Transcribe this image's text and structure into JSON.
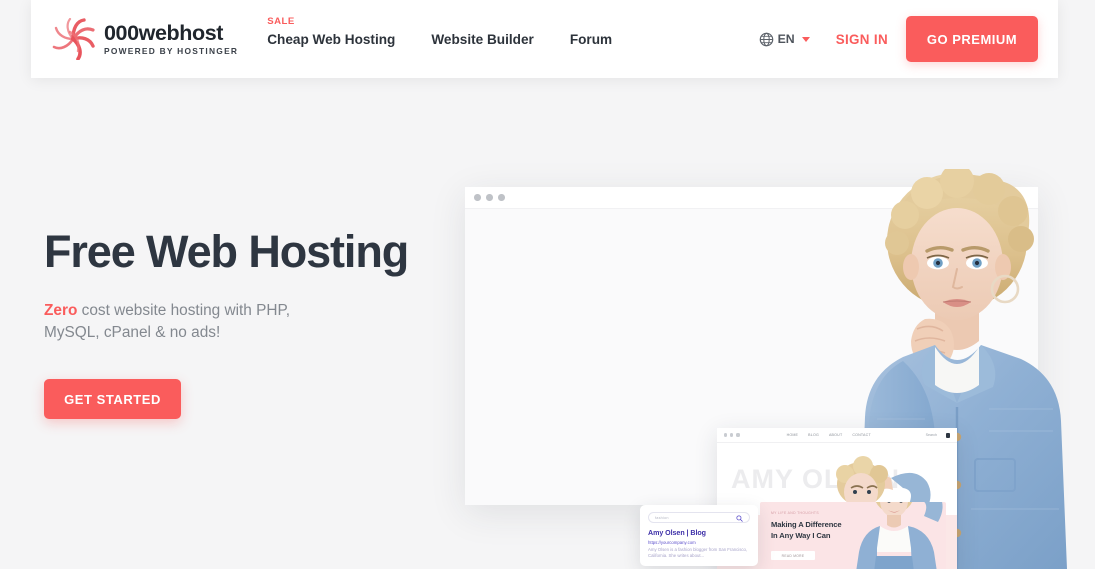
{
  "header": {
    "brand": {
      "name": "000webhost",
      "tagline": "POWERED BY HOSTINGER",
      "logo_icon": "swirl-logo-icon"
    },
    "nav": [
      {
        "label": "Cheap Web Hosting",
        "badge": "SALE"
      },
      {
        "label": "Website Builder",
        "badge": ""
      },
      {
        "label": "Forum",
        "badge": ""
      }
    ],
    "language": {
      "icon": "globe-icon",
      "label": "EN",
      "caret_icon": "chevron-down-icon"
    },
    "signin_label": "SIGN IN",
    "premium_label": "GO PREMIUM"
  },
  "hero": {
    "title": "Free Web Hosting",
    "sub_accent": "Zero",
    "sub_rest": " cost website hosting with PHP, MySQL, cPanel & no ads!",
    "cta_label": "GET STARTED"
  },
  "mockups": {
    "browser_main": {
      "dots_icon": "window-dots-icon"
    },
    "browser_two": {
      "dots_icon": "window-dots-icon",
      "nav": [
        "HOME",
        "BLOG",
        "ABOUT",
        "CONTACT"
      ],
      "search_label": "Search",
      "cart_icon": "shopping-bag-icon",
      "site_title": "AMY OLSEN"
    },
    "search_card": {
      "search_placeholder": "fashion",
      "search_icon": "magnifier-icon",
      "result_title": "Amy Olsen | Blog",
      "result_url": "https://yourcompany.com",
      "result_desc": "Amy Olsen is a fashion blogger from San Francisco, California. She writes about..."
    },
    "promo_card": {
      "kicker": "MY LIFE AND THOUGHTS",
      "headline_line1": "Making A Difference",
      "headline_line2": "In Any Way I Can",
      "button_label": "READ MORE"
    }
  },
  "colors": {
    "accent": "#fa5c5c",
    "heading": "#2e3641",
    "body_text": "#83888f",
    "page_bg": "#f5f5f6",
    "promo_pink": "#fbe4e6",
    "result_purple": "#3d2fa8"
  }
}
